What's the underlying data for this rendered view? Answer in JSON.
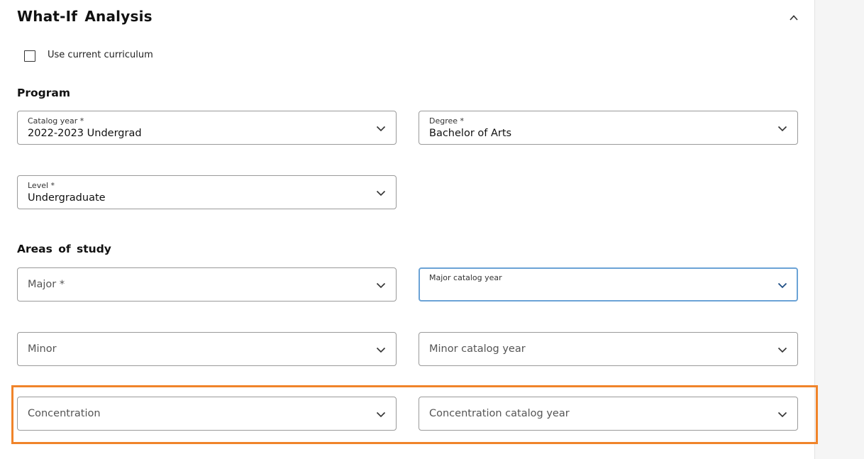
{
  "header": {
    "title": "What-If Analysis",
    "collapse_icon": "chevron-up-icon"
  },
  "use_current": {
    "label": "Use current curriculum",
    "checked": false
  },
  "program": {
    "title": "Program",
    "catalog_year": {
      "label": "Catalog year *",
      "value": "2022-2023 Undergrad"
    },
    "degree": {
      "label": "Degree *",
      "value": "Bachelor of Arts"
    },
    "level": {
      "label": "Level *",
      "value": "Undergraduate"
    }
  },
  "areas": {
    "title": "Areas of study",
    "major": {
      "placeholder": "Major *"
    },
    "major_catalog_year": {
      "label": "Major catalog year",
      "value": ""
    },
    "minor": {
      "placeholder": "Minor"
    },
    "minor_catalog_year": {
      "placeholder": "Minor catalog year"
    },
    "concentration": {
      "placeholder": "Concentration"
    },
    "concentration_catalog_year": {
      "placeholder": "Concentration catalog year"
    }
  },
  "colors": {
    "focus": "#6ba3d6",
    "highlight": "#f0842a"
  }
}
